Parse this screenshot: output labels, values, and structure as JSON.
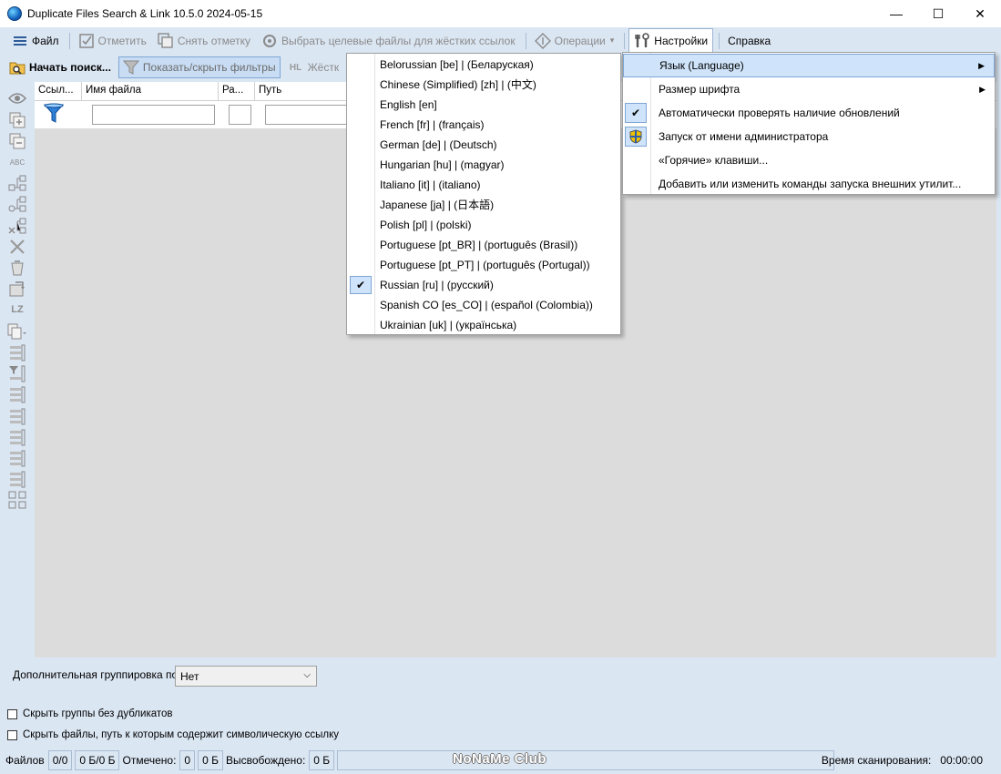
{
  "window": {
    "title": "Duplicate Files Search & Link 10.5.0 2024-05-15",
    "minimize": "—",
    "maximize": "☐",
    "close": "✕"
  },
  "menu": {
    "file": "Файл",
    "mark": "Отметить",
    "unmark": "Снять отметку",
    "select_targets": "Выбрать целевые файлы для жёстких ссылок",
    "operations": "Операции",
    "settings": "Настройки",
    "help": "Справка"
  },
  "toolbar": {
    "start_search": "Начать поиск...",
    "toggle_filters": "Показать/скрыть фильтры",
    "hardlinks": "Жёстк"
  },
  "grid": {
    "columns": [
      "Ссыл...",
      "Имя файла",
      "Ра...",
      "Путь"
    ]
  },
  "grouping": {
    "label": "Дополнительная группировка по",
    "value": "Нет"
  },
  "options": {
    "hide_groups_no_dupes": "Скрыть группы без дубликатов",
    "hide_symlink_paths": "Скрыть файлы, путь к которым содержит символическую ссылку"
  },
  "status": {
    "files_label": "Файлов",
    "files_count": "0/0",
    "files_size": "0 Б/0 Б",
    "marked_label": "Отмечено:",
    "marked_count": "0",
    "marked_size": "0 Б",
    "freed_label": "Высвобождено:",
    "freed_size": "0 Б",
    "watermark": "NoNaMe Club",
    "scan_time_label": "Время сканирования:",
    "scan_time": "00:00:00"
  },
  "settings_menu": {
    "items": [
      "Язык (Language)",
      "Размер шрифта",
      "Автоматически проверять наличие обновлений",
      "Запуск от имени администратора",
      "«Горячие» клавиши...",
      "Добавить или изменить команды запуска внешних утилит..."
    ]
  },
  "language_menu": {
    "items": [
      "Belorussian [be] | (Беларуская)",
      "Chinese (Simplified) [zh] | (中文)",
      "English [en]",
      "French [fr] | (français)",
      "German [de] | (Deutsch)",
      "Hungarian [hu] | (magyar)",
      "Italiano [it] | (italiano)",
      "Japanese [ja] | (日本語)",
      "Polish [pl] | (polski)",
      "Portuguese [pt_BR] | (português (Brasil))",
      "Portuguese [pt_PT] | (português (Portugal))",
      "Russian [ru] | (русский)",
      "Spanish CO [es_CO] | (español (Colombia))",
      "Ukrainian [uk] | (українська)"
    ],
    "selected": "Russian [ru] | (русский)"
  },
  "colors": {
    "app_background": "#dbe6f3",
    "grid_background": "#dcdcdc",
    "menu_highlight": "#cfe4fa",
    "highlight_border": "#7fa6d4"
  }
}
